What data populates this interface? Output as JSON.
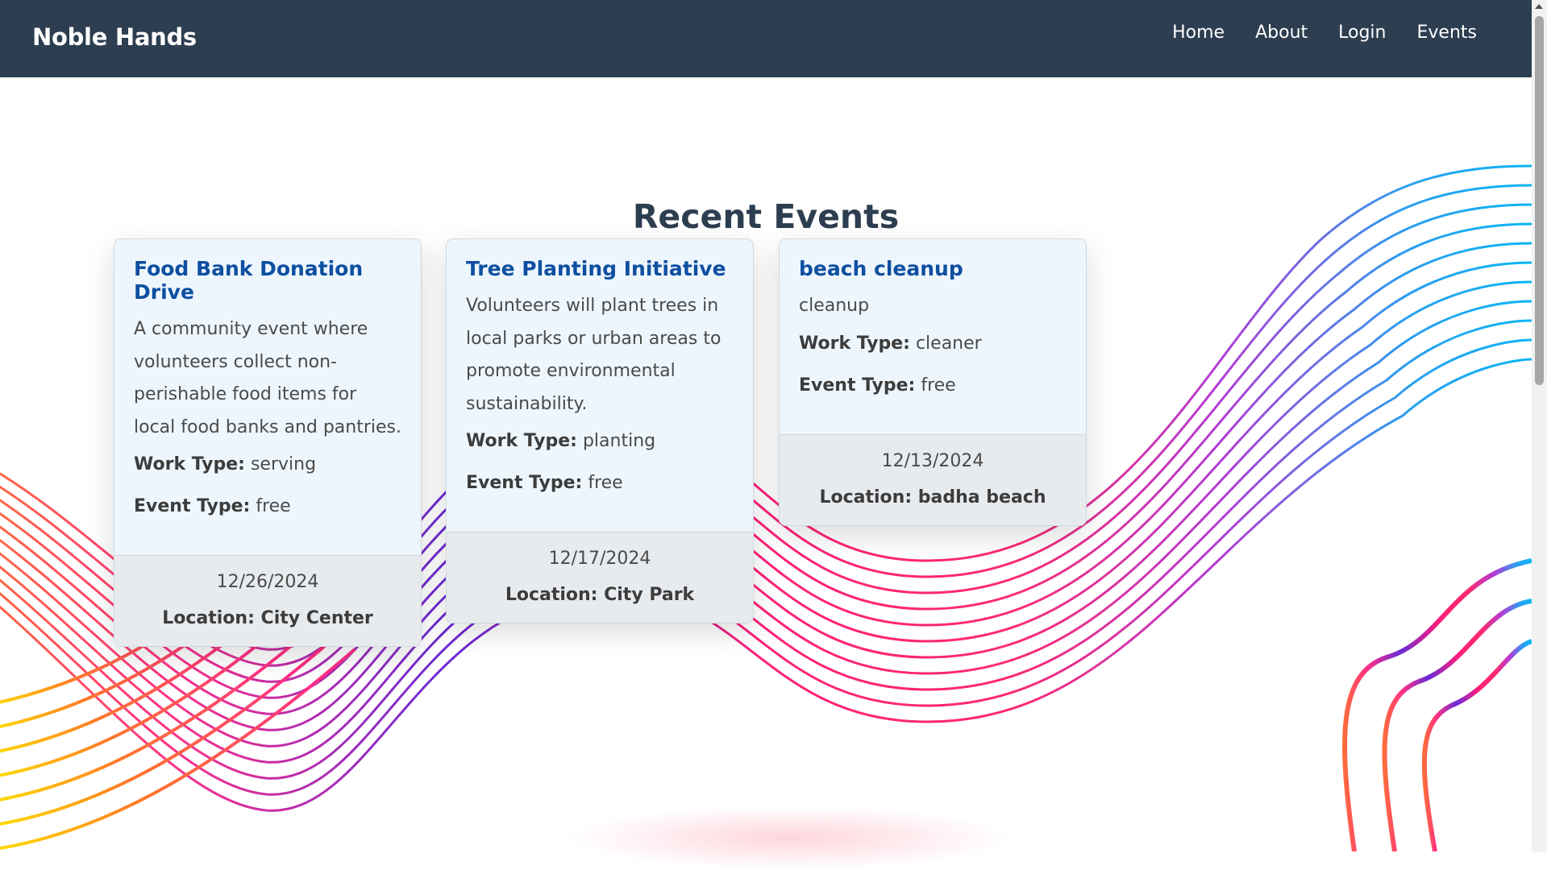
{
  "navbar": {
    "brand": "Noble Hands",
    "links": [
      "Home",
      "About",
      "Login",
      "Events"
    ]
  },
  "section": {
    "title": "Recent Events"
  },
  "events": [
    {
      "title": "Food Bank Donation Drive",
      "description": "A community event where volunteers collect non-perishable food items for local food banks and pantries.",
      "work_type_label": "Work Type:",
      "work_type": "serving",
      "event_type_label": "Event Type:",
      "event_type": "free",
      "date": "12/26/2024",
      "location": "Location: City Center"
    },
    {
      "title": "Tree Planting Initiative",
      "description": "Volunteers will plant trees in local parks or urban areas to promote environmental sustainability.",
      "work_type_label": "Work Type:",
      "work_type": "planting",
      "event_type_label": "Event Type:",
      "event_type": "free",
      "date": "12/17/2024",
      "location": "Location: City Park"
    },
    {
      "title": "beach cleanup",
      "description": "cleanup",
      "work_type_label": "Work Type:",
      "work_type": "cleaner",
      "event_type_label": "Event Type:",
      "event_type": "free",
      "date": "12/13/2024",
      "location": "Location: badha beach"
    }
  ],
  "colors": {
    "navbar": "#2d3e50",
    "card_title": "#0e4fa1",
    "card_background": "#eef6fd",
    "card_footer": "#e8ebee"
  },
  "decor": {
    "background": "colorful-wave-lines"
  }
}
